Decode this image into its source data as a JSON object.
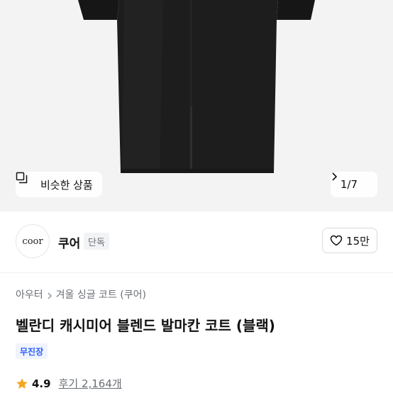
{
  "gallery": {
    "similar_label": "비슷한 상품",
    "pager": "1/7"
  },
  "brand": {
    "logo_text": "coor",
    "name": "쿠어",
    "badge": "단독",
    "likes": "15만"
  },
  "product": {
    "breadcrumb": [
      "아우터",
      "겨울 싱글 코트 (쿠어)"
    ],
    "title": "벨란디 캐시미어 블렌드 발마칸 코트 (블랙)",
    "shipping_badge": "무진장",
    "rating": "4.9",
    "reviews": "후기 2,164개"
  },
  "colors": {
    "star": "#f5a623",
    "badge_blue": "#2b5ef5",
    "coat": "#1c1c1c"
  },
  "icons": {
    "similar": "similar-products-icon",
    "pager_next": "chevron-right-icon",
    "like": "heart-outline-icon",
    "breadcrumb_sep": "chevron-right-icon",
    "rating": "star-icon"
  }
}
